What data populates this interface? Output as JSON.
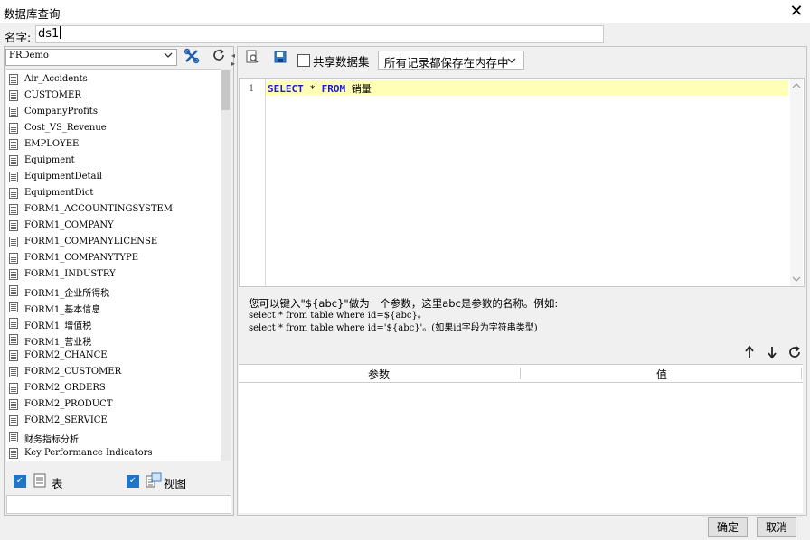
{
  "window": {
    "title": "数据库查询",
    "close_glyph": "✕"
  },
  "name_field": {
    "label": "名字:",
    "value": "ds1"
  },
  "left": {
    "datasource": "FRDemo",
    "tables": [
      "Air_Accidents",
      "CUSTOMER",
      "CompanyProfits",
      "Cost_VS_Revenue",
      "EMPLOYEE",
      "Equipment",
      "EquipmentDetail",
      "EquipmentDict",
      "FORM1_ACCOUNTINGSYSTEM",
      "FORM1_COMPANY",
      "FORM1_COMPANYLICENSE",
      "FORM1_COMPANYTYPE",
      "FORM1_INDUSTRY",
      "FORM1_企业所得税",
      "FORM1_基本信息",
      "FORM1_增值税",
      "FORM1_营业税",
      "FORM2_CHANCE",
      "FORM2_CUSTOMER",
      "FORM2_ORDERS",
      "FORM2_PRODUCT",
      "FORM2_SERVICE",
      "财务指标分析",
      "Key Performance Indicators"
    ],
    "filter_table_label": "表",
    "filter_view_label": "视图"
  },
  "right": {
    "share_label": "共享数据集",
    "mode_value": "所有记录都保存在内存中",
    "line_number": "1",
    "sql": {
      "kw1": "SELECT",
      "star": " * ",
      "kw2": "FROM",
      "table": " 销量"
    },
    "help_line1": "您可以键入\"${abc}\"做为一个参数，这里abc是参数的名称。例如:",
    "help_line2": "select * from table where id=${abc}。",
    "help_line3": "select * from table where id='${abc}'。(如果id字段为字符串类型)",
    "param_col": "参数",
    "value_col": "值"
  },
  "buttons": {
    "ok": "确定",
    "cancel": "取消"
  }
}
